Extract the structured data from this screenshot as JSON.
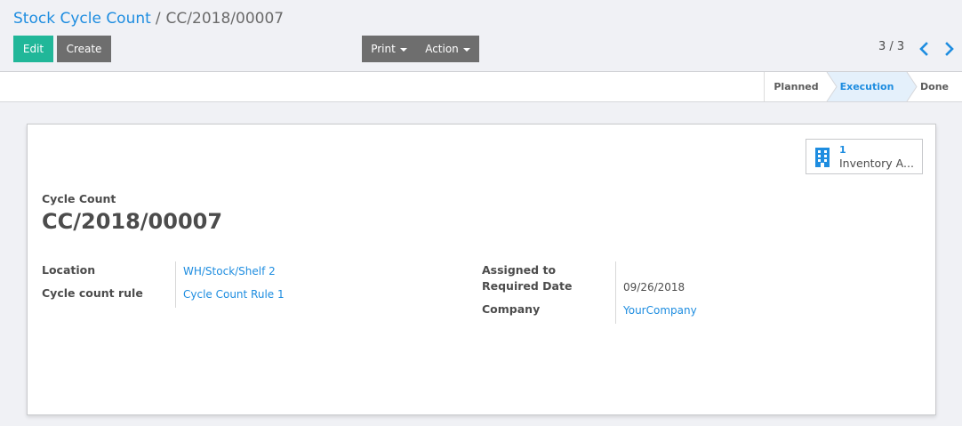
{
  "breadcrumb": {
    "parent": "Stock Cycle Count",
    "separator": "/",
    "current": "CC/2018/00007"
  },
  "toolbar": {
    "edit_label": "Edit",
    "create_label": "Create",
    "print_label": "Print",
    "action_label": "Action"
  },
  "pager": {
    "value": "3 / 3"
  },
  "statusbar": {
    "steps": [
      "Planned",
      "Execution",
      "Done"
    ],
    "active": "Execution"
  },
  "smart_button": {
    "count": "1",
    "label": "Inventory A...",
    "icon": "building-icon"
  },
  "record": {
    "label": "Cycle Count",
    "name": "CC/2018/00007"
  },
  "fields_left": {
    "location_label": "Location",
    "location_value": "WH/Stock/Shelf 2",
    "rule_label": "Cycle count rule",
    "rule_value": "Cycle Count Rule 1"
  },
  "fields_right": {
    "assigned_label": "Assigned to",
    "assigned_value": "",
    "date_label": "Required Date",
    "date_value": "09/26/2018",
    "company_label": "Company",
    "company_value": "YourCompany"
  },
  "colors": {
    "brand_primary": "#21b799",
    "link": "#1e8de0",
    "secondary_button": "#6e6e6e",
    "active_step_bg": "#e4f0fb"
  }
}
